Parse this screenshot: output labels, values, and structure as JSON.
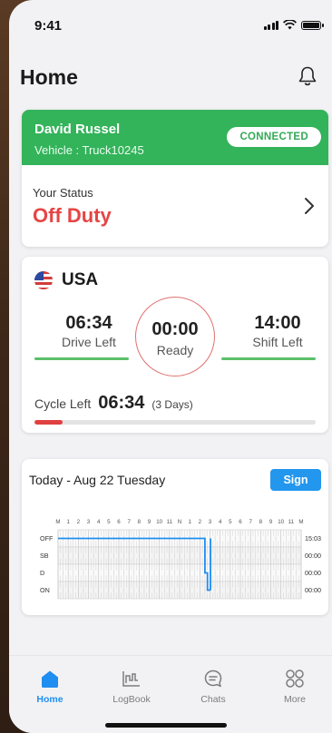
{
  "status_bar": {
    "time": "9:41"
  },
  "header": {
    "title": "Home"
  },
  "driver": {
    "name": "David Russel",
    "vehicle": "Vehicle : Truck10245",
    "connection": "CONNECTED",
    "status_label": "Your Status",
    "status_value": "Off Duty",
    "accent_color": "#33b35a",
    "status_color": "#e64545"
  },
  "hos": {
    "country": "USA",
    "drive_left": {
      "value": "06:34",
      "label": "Drive Left"
    },
    "center": {
      "value": "00:00",
      "label": "Ready"
    },
    "shift_left": {
      "value": "14:00",
      "label": "Shift Left"
    },
    "cycle": {
      "label": "Cycle Left",
      "value": "06:34",
      "days": "(3 Days)",
      "progress": 0.1
    }
  },
  "log": {
    "date": "Today - Aug 22 Tuesday",
    "sign_label": "Sign",
    "hour_labels": [
      "M",
      "1",
      "2",
      "3",
      "4",
      "5",
      "6",
      "7",
      "8",
      "9",
      "10",
      "11",
      "N",
      "1",
      "2",
      "3",
      "4",
      "5",
      "6",
      "7",
      "8",
      "9",
      "10",
      "11",
      "M"
    ],
    "rows": [
      {
        "label": "OFF",
        "total": "15:03"
      },
      {
        "label": "SB",
        "total": "00:00"
      },
      {
        "label": "D",
        "total": "00:00"
      },
      {
        "label": "ON",
        "total": "00:00"
      }
    ],
    "segments": [
      {
        "status": "OFF",
        "start": 0,
        "end": 14.5
      },
      {
        "status": "D",
        "start": 14.5,
        "end": 14.75
      },
      {
        "status": "ON",
        "start": 14.75,
        "end": 15.05
      }
    ],
    "line_color": "#1f8ef1"
  },
  "tabs": [
    {
      "label": "Home",
      "icon": "home-icon",
      "active": true
    },
    {
      "label": "LogBook",
      "icon": "logbook-icon",
      "active": false
    },
    {
      "label": "Chats",
      "icon": "chats-icon",
      "active": false
    },
    {
      "label": "More",
      "icon": "more-icon",
      "active": false
    }
  ]
}
